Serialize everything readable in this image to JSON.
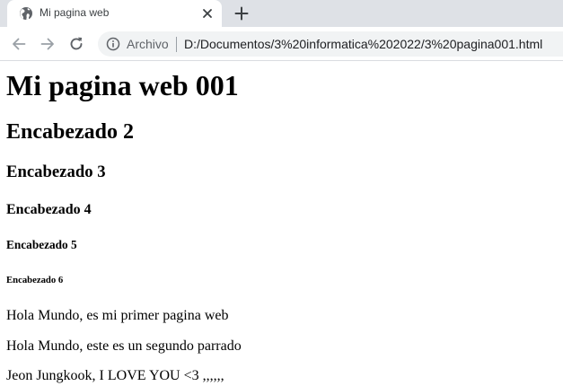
{
  "browser": {
    "tab": {
      "title": "Mi pagina web",
      "favicon": "globe-icon"
    },
    "toolbar": {
      "back_icon": "arrow-left-icon",
      "forward_icon": "arrow-right-icon",
      "reload_icon": "reload-icon",
      "site_info_icon": "info-icon",
      "site_info_label": "Archivo",
      "url": "D:/Documentos/3%20informatica%202022/3%20pagina001.html"
    },
    "colors": {
      "tabstrip": "#dee1e6",
      "omnibox": "#f1f3f4",
      "icon": "#5f6368"
    }
  },
  "page": {
    "headings": [
      "Mi pagina web 001",
      "Encabezado 2",
      "Encabezado 3",
      "Encabezado 4",
      "Encabezado 5",
      "Encabezado 6"
    ],
    "paragraphs": [
      "Hola Mundo, es mi primer pagina web",
      "Hola Mundo, este es un segundo parrado",
      "Jeon Jungkook, I LOVE YOU <3 ,,,,,,"
    ]
  }
}
